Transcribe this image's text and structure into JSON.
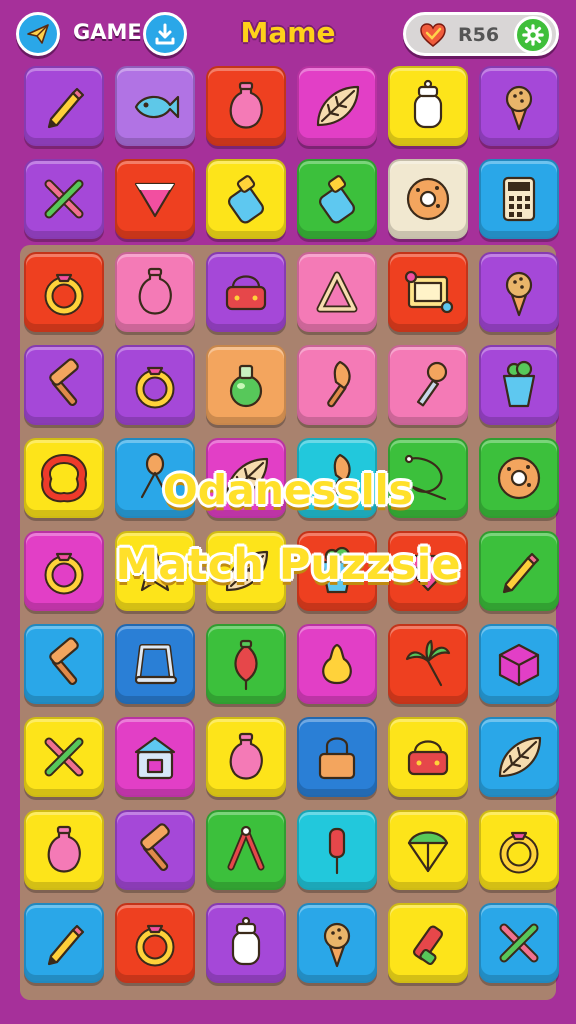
{
  "header": {
    "back_icon": "paper-plane-icon",
    "game_label": "GAME",
    "download_icon": "download-icon",
    "title": "Mame",
    "currency_icon": "heart-icon",
    "currency_value": "R56",
    "settings_icon": "gear-icon"
  },
  "overlay": {
    "line1": "Odanesslls",
    "line2": "Match Puzzsie"
  },
  "colors": {
    "purple": "#a548d8",
    "lavender": "#b173e4",
    "red": "#ee4020",
    "magenta": "#e23fc6",
    "yellow": "#fde41a",
    "green": "#3cc03c",
    "cream": "#f1e8d0",
    "sky": "#2aa7e8",
    "pink": "#f47ab6",
    "peach": "#f3a55e",
    "teal": "#22c8dc",
    "lime": "#77cc2f",
    "blue": "#2a7fd6",
    "orange": "#f38a2a"
  },
  "board": {
    "rows": [
      [
        {
          "icon": "pencil-icon",
          "color": "#a548d8"
        },
        {
          "icon": "fish-icon",
          "color": "#b173e4"
        },
        {
          "icon": "vase-icon",
          "color": "#ee4020"
        },
        {
          "icon": "leaf-icon",
          "color": "#e23fc6"
        },
        {
          "icon": "jar-icon",
          "color": "#fde41a"
        },
        {
          "icon": "ice-cream-icon",
          "color": "#a548d8"
        }
      ],
      [
        {
          "icon": "crossed-tools-icon",
          "color": "#a548d8"
        },
        {
          "icon": "triangle-gem-icon",
          "color": "#ee4020"
        },
        {
          "icon": "bottle-icon",
          "color": "#fde41a"
        },
        {
          "icon": "bottle-icon",
          "color": "#3cc03c"
        },
        {
          "icon": "donut-icon",
          "color": "#f1e8d0"
        },
        {
          "icon": "calculator-icon",
          "color": "#2aa7e8"
        }
      ],
      [
        {
          "icon": "ring-icon",
          "color": "#ee4020"
        },
        {
          "icon": "vase-icon",
          "color": "#f47ab6"
        },
        {
          "icon": "basket-icon",
          "color": "#a548d8"
        },
        {
          "icon": "triangle-icon",
          "color": "#f47ab6"
        },
        {
          "icon": "frame-icon",
          "color": "#ee4020"
        },
        {
          "icon": "ice-cream-icon",
          "color": "#a548d8"
        }
      ],
      [
        {
          "icon": "hammer-icon",
          "color": "#a548d8"
        },
        {
          "icon": "ring-icon",
          "color": "#a548d8"
        },
        {
          "icon": "potion-icon",
          "color": "#f3a55e"
        },
        {
          "icon": "brush-icon",
          "color": "#f47ab6"
        },
        {
          "icon": "dropper-icon",
          "color": "#f47ab6"
        },
        {
          "icon": "cup-icon",
          "color": "#a548d8"
        }
      ],
      [
        {
          "icon": "pretzel-icon",
          "color": "#fde41a"
        },
        {
          "icon": "spoon-icon",
          "color": "#2aa7e8"
        },
        {
          "icon": "leaf-icon",
          "color": "#e23fc6"
        },
        {
          "icon": "brush-icon",
          "color": "#22c8dc"
        },
        {
          "icon": "rope-icon",
          "color": "#3cc03c"
        },
        {
          "icon": "donut-icon",
          "color": "#3cc03c"
        }
      ],
      [
        {
          "icon": "ring-icon",
          "color": "#e23fc6"
        },
        {
          "icon": "star-icon",
          "color": "#fde41a"
        },
        {
          "icon": "leaf-icon",
          "color": "#fde41a"
        },
        {
          "icon": "cup-icon",
          "color": "#ee4020"
        },
        {
          "icon": "gem-icon",
          "color": "#ee4020"
        },
        {
          "icon": "pencil-icon",
          "color": "#3cc03c"
        }
      ],
      [
        {
          "icon": "hammer-icon",
          "color": "#2aa7e8"
        },
        {
          "icon": "saw-icon",
          "color": "#2a7fd6"
        },
        {
          "icon": "bulb-icon",
          "color": "#3cc03c"
        },
        {
          "icon": "pear-icon",
          "color": "#e23fc6"
        },
        {
          "icon": "palm-icon",
          "color": "#ee4020"
        },
        {
          "icon": "box-icon",
          "color": "#2aa7e8"
        }
      ],
      [
        {
          "icon": "crossed-tools-icon",
          "color": "#fde41a"
        },
        {
          "icon": "house-icon",
          "color": "#e23fc6"
        },
        {
          "icon": "vase-icon",
          "color": "#fde41a"
        },
        {
          "icon": "lock-icon",
          "color": "#2a7fd6"
        },
        {
          "icon": "basket-icon",
          "color": "#fde41a"
        },
        {
          "icon": "leaf-icon",
          "color": "#2aa7e8"
        }
      ],
      [
        {
          "icon": "vase-icon",
          "color": "#fde41a"
        },
        {
          "icon": "hammer-icon",
          "color": "#a548d8"
        },
        {
          "icon": "tongs-icon",
          "color": "#3cc03c"
        },
        {
          "icon": "popsicle-icon",
          "color": "#22c8dc"
        },
        {
          "icon": "umbrella-icon",
          "color": "#fde41a"
        },
        {
          "icon": "ring-icon",
          "color": "#fde41a"
        }
      ],
      [
        {
          "icon": "pencil-icon",
          "color": "#2aa7e8"
        },
        {
          "icon": "ring-icon",
          "color": "#ee4020"
        },
        {
          "icon": "jar-icon",
          "color": "#a548d8"
        },
        {
          "icon": "ice-cream-icon",
          "color": "#2aa7e8"
        },
        {
          "icon": "marker-icon",
          "color": "#fde41a"
        },
        {
          "icon": "crossed-tools-icon",
          "color": "#2aa7e8"
        }
      ]
    ]
  }
}
